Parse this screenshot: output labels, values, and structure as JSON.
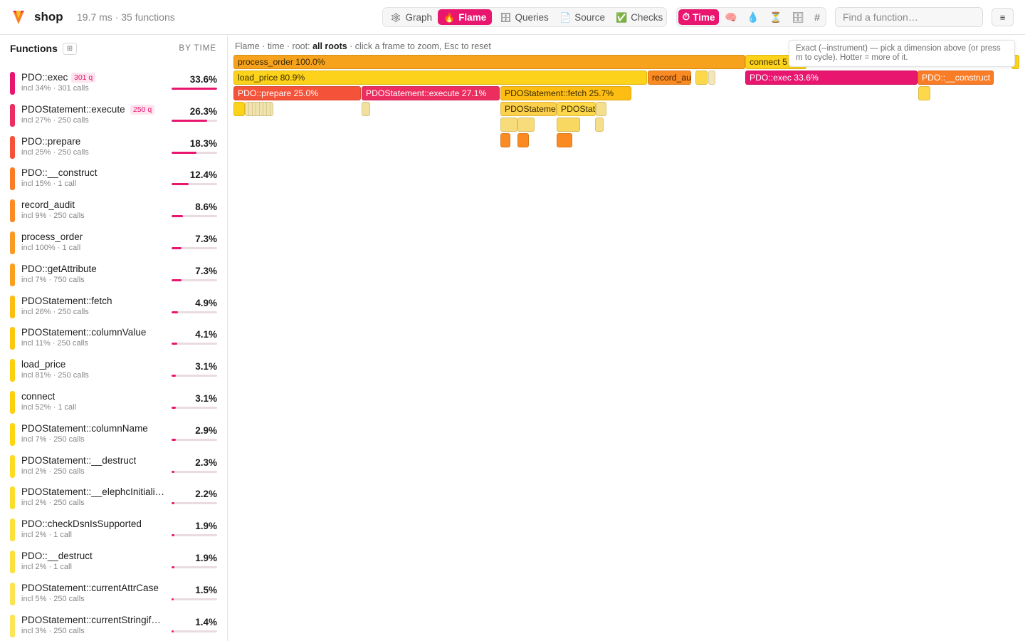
{
  "app": {
    "name": "shop",
    "stats": "19.7 ms · 35 functions"
  },
  "view_tabs": [
    {
      "label": "Graph",
      "icon": "🕸",
      "active": false
    },
    {
      "label": "Flame",
      "icon": "🔥",
      "active": true
    },
    {
      "label": "Queries",
      "icon": "🗄",
      "active": false
    },
    {
      "label": "Source",
      "icon": "📄",
      "active": false
    },
    {
      "label": "Checks",
      "icon": "✅",
      "active": false
    }
  ],
  "dimensions": [
    {
      "label": "Time",
      "icon": "⏱",
      "active": true
    },
    {
      "label": "",
      "icon": "🧠",
      "active": false
    },
    {
      "label": "",
      "icon": "💧",
      "active": false
    },
    {
      "label": "",
      "icon": "⏳",
      "active": false
    },
    {
      "label": "",
      "icon": "🗄",
      "active": false
    },
    {
      "label": "",
      "icon": "#",
      "active": false
    }
  ],
  "search": {
    "placeholder": "Find a function…"
  },
  "menu_icon": "≡",
  "sidebar": {
    "title": "Functions",
    "toggle_icon": "⊞",
    "sort_label": "BY TIME",
    "functions": [
      {
        "name": "PDO::exec",
        "badge": "301 q",
        "meta": "incl 34% · 301 calls",
        "pct": "33.6%",
        "value": 33.6,
        "color": "#e8166f"
      },
      {
        "name": "PDOStatement::execute",
        "badge": "250 q",
        "meta": "incl 27% · 250 calls",
        "pct": "26.3%",
        "value": 26.3,
        "color": "#ec2d5f"
      },
      {
        "name": "PDO::prepare",
        "badge": "",
        "meta": "incl 25% · 250 calls",
        "pct": "18.3%",
        "value": 18.3,
        "color": "#f4533a"
      },
      {
        "name": "PDO::__construct",
        "badge": "",
        "meta": "incl 15% · 1 call",
        "pct": "12.4%",
        "value": 12.4,
        "color": "#f97c27"
      },
      {
        "name": "record_audit",
        "badge": "",
        "meta": "incl 9% · 250 calls",
        "pct": "8.6%",
        "value": 8.6,
        "color": "#fb8b24"
      },
      {
        "name": "process_order",
        "badge": "",
        "meta": "incl 100% · 1 call",
        "pct": "7.3%",
        "value": 7.3,
        "color": "#fb9a22"
      },
      {
        "name": "PDO::getAttribute",
        "badge": "",
        "meta": "incl 7% · 750 calls",
        "pct": "7.3%",
        "value": 7.3,
        "color": "#fc9f1f"
      },
      {
        "name": "PDOStatement::fetch",
        "badge": "",
        "meta": "incl 26% · 250 calls",
        "pct": "4.9%",
        "value": 4.9,
        "color": "#fdbd12"
      },
      {
        "name": "PDOStatement::columnValue",
        "badge": "",
        "meta": "incl 11% · 250 calls",
        "pct": "4.1%",
        "value": 4.1,
        "color": "#fdc70f"
      },
      {
        "name": "load_price",
        "badge": "",
        "meta": "incl 81% · 250 calls",
        "pct": "3.1%",
        "value": 3.1,
        "color": "#fdd00f"
      },
      {
        "name": "connect",
        "badge": "",
        "meta": "incl 52% · 1 call",
        "pct": "3.1%",
        "value": 3.1,
        "color": "#fdd00f"
      },
      {
        "name": "PDOStatement::columnName",
        "badge": "",
        "meta": "incl 7% · 250 calls",
        "pct": "2.9%",
        "value": 2.9,
        "color": "#fdd513"
      },
      {
        "name": "PDOStatement::__destruct",
        "badge": "",
        "meta": "incl 2% · 250 calls",
        "pct": "2.3%",
        "value": 2.3,
        "color": "#fddb22"
      },
      {
        "name": "PDOStatement::__elephcInitiali…",
        "badge": "",
        "meta": "incl 2% · 250 calls",
        "pct": "2.2%",
        "value": 2.2,
        "color": "#fddd2c"
      },
      {
        "name": "PDO::checkDsnIsSupported",
        "badge": "",
        "meta": "incl 2% · 1 call",
        "pct": "1.9%",
        "value": 1.9,
        "color": "#fde03a"
      },
      {
        "name": "PDO::__destruct",
        "badge": "",
        "meta": "incl 2% · 1 call",
        "pct": "1.9%",
        "value": 1.9,
        "color": "#fde03e"
      },
      {
        "name": "PDOStatement::currentAttrCase",
        "badge": "",
        "meta": "incl 5% · 250 calls",
        "pct": "1.5%",
        "value": 1.5,
        "color": "#fde352"
      },
      {
        "name": "PDOStatement::currentStringif…",
        "badge": "",
        "meta": "incl 3% · 250 calls",
        "pct": "1.4%",
        "value": 1.4,
        "color": "#fde458"
      }
    ]
  },
  "flame": {
    "crumb_prefix": "Flame · time · root:",
    "crumb_root": "all roots",
    "crumb_suffix": "· click a frame to zoom, Esc to reset",
    "tooltip": "Exact (--instrument) — pick a dimension above (or press m to cycle). Hotter = more of it.",
    "frames": [
      {
        "label": "process_order 100.0%",
        "fn": "process_order",
        "color": "#f6a21c",
        "text": "#3a2a00"
      },
      {
        "label": "connect 5",
        "fn": "connect",
        "color": "#fcd21a",
        "text": "#3a2a00"
      },
      {
        "label": "",
        "fn": "connect-tail",
        "color": "#fcd21a",
        "text": "#3a2a00"
      },
      {
        "label": "load_price 80.9%",
        "fn": "load_price",
        "color": "#fcd21a",
        "text": "#3a2a00"
      },
      {
        "label": "record_au",
        "fn": "record_audit",
        "color": "#f98b22",
        "text": "#3a1a00"
      },
      {
        "label": "",
        "fn": "small-yellow",
        "color": "#fcd84a",
        "text": "#3a2a00"
      },
      {
        "label": "",
        "fn": "small-pale",
        "color": "#f3e6b8",
        "text": "#3a2a00"
      },
      {
        "label": "PDO::exec 33.6%",
        "fn": "PDO::exec",
        "color": "#e8166f",
        "text": "#ffffff"
      },
      {
        "label": "PDO::__construct",
        "fn": "PDO::__construct",
        "color": "#f97c27",
        "text": "#ffffff"
      },
      {
        "label": "PDO::prepare 25.0%",
        "fn": "PDO::prepare",
        "color": "#f4533a",
        "text": "#ffffff"
      },
      {
        "label": "PDOStatement::execute 27.1%",
        "fn": "PDOStatement::execute",
        "color": "#ec2d5f",
        "text": "#ffffff"
      },
      {
        "label": "PDOStatement::fetch 25.7%",
        "fn": "PDOStatement::fetch",
        "color": "#fdbd12",
        "text": "#3a2a00"
      },
      {
        "label": "",
        "fn": "construct-child",
        "color": "#fcd84a",
        "text": "#3a2a00"
      },
      {
        "label": "",
        "fn": "prepare-child",
        "color": "#fcd21a",
        "text": "#3a2a00"
      },
      {
        "label": "",
        "fn": "prepare-tiny",
        "color": "#f1e3b0",
        "text": "#3a2a00"
      },
      {
        "label": "",
        "fn": "execute-child",
        "color": "#f1e0a0",
        "text": "#3a2a00"
      },
      {
        "label": "PDOStatemen",
        "fn": "PDOStatement::columnValue",
        "color": "#fcd04a",
        "text": "#3a2a00"
      },
      {
        "label": "PDOStat",
        "fn": "PDOStatement::columnName",
        "color": "#fcd84a",
        "text": "#3a2a00"
      },
      {
        "label": "",
        "fn": "fetch-tail",
        "color": "#f6df8a",
        "text": "#3a2a00"
      },
      {
        "label": "",
        "fn": "cv-child-a",
        "color": "#f8dc7a",
        "text": "#3a2a00"
      },
      {
        "label": "",
        "fn": "cv-child-b",
        "color": "#f8dc7a",
        "text": "#3a2a00"
      },
      {
        "label": "",
        "fn": "cn-child",
        "color": "#f8d860",
        "text": "#3a2a00"
      },
      {
        "label": "",
        "fn": "tail-child",
        "color": "#f6df8a",
        "text": "#3a2a00"
      },
      {
        "label": "",
        "fn": "cv-leaf-a",
        "color": "#f98b22",
        "text": "#3a2a00"
      },
      {
        "label": "",
        "fn": "cv-leaf-b",
        "color": "#f98b22",
        "text": "#3a2a00"
      },
      {
        "label": "",
        "fn": "cn-leaf",
        "color": "#f98b22",
        "text": "#3a2a00"
      }
    ]
  }
}
